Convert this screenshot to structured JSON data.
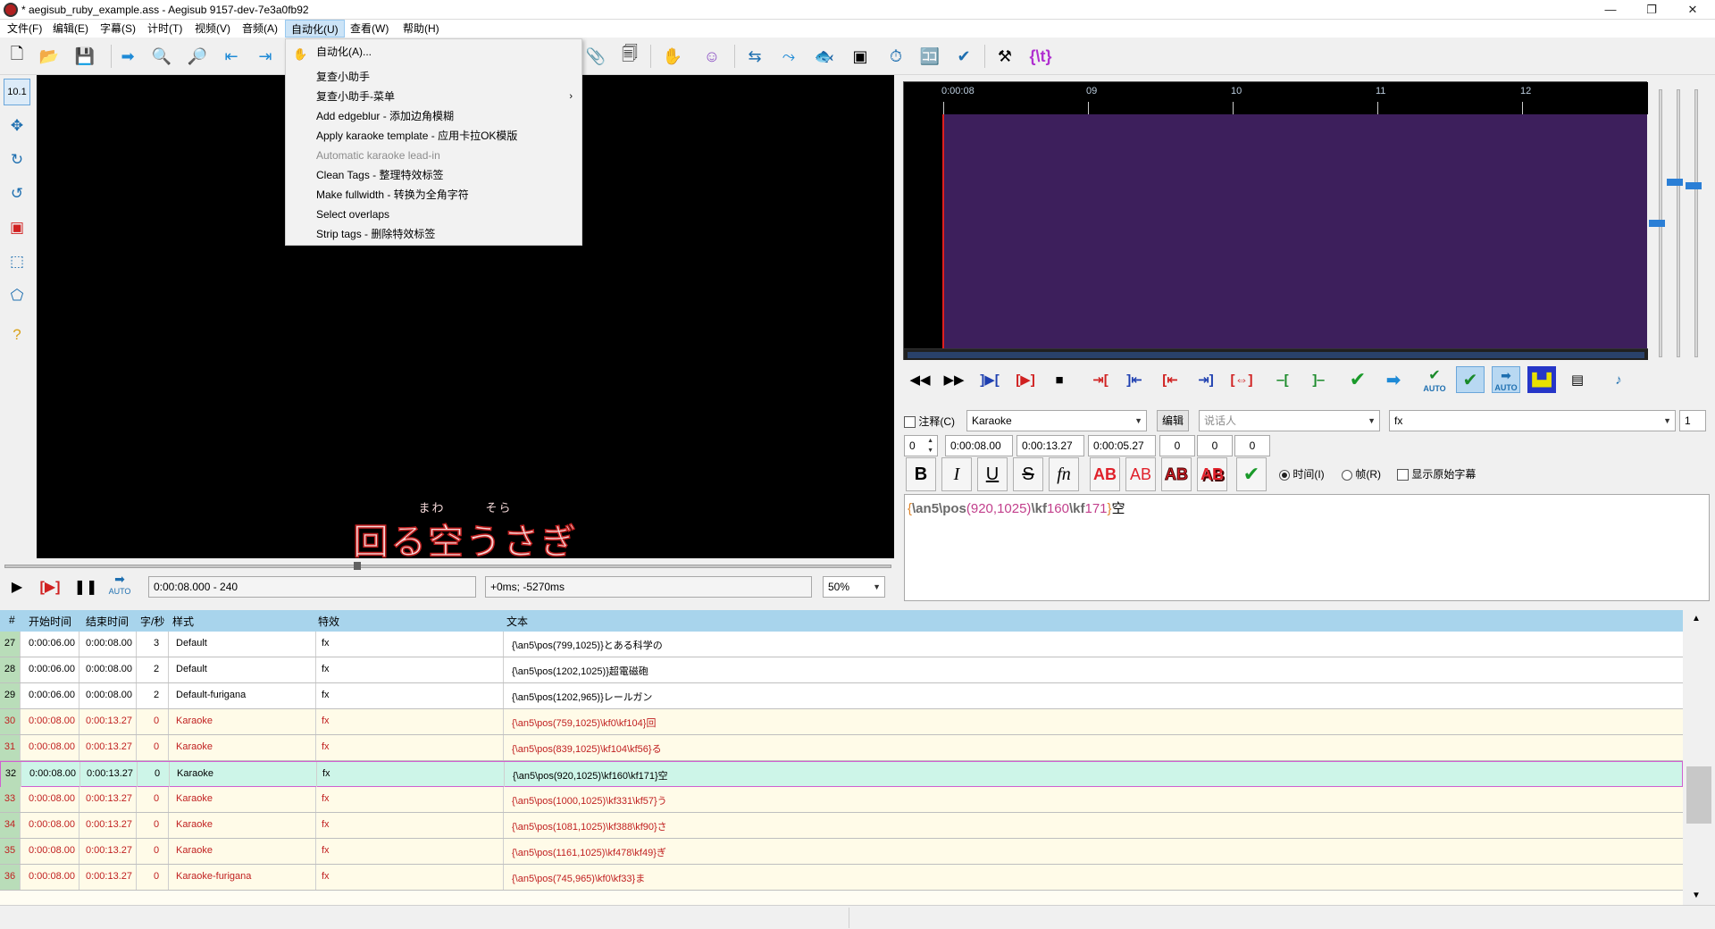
{
  "window": {
    "title": "* aegisub_ruby_example.ass - Aegisub 9157-dev-7e3a0fb92",
    "controls": [
      "—",
      "❐",
      "✕"
    ]
  },
  "menu": [
    "文件(F)",
    "编辑(E)",
    "字幕(S)",
    "计时(T)",
    "视频(V)",
    "音频(A)",
    "自动化(U)",
    "查看(W)",
    "帮助(H)"
  ],
  "automation_menu": {
    "items": [
      {
        "label": "自动化(A)..."
      },
      {
        "label": "复查小助手"
      },
      {
        "label": "复查小助手-菜单",
        "submenu": true
      },
      {
        "label": "Add edgeblur - 添加边角模糊"
      },
      {
        "label": "Apply karaoke template - 应用卡拉OK模版"
      },
      {
        "label": "Automatic karaoke lead-in",
        "disabled": true
      },
      {
        "label": "Clean Tags - 整理特效标签"
      },
      {
        "label": "Make fullwidth - 转换为全角字符"
      },
      {
        "label": "Select overlaps"
      },
      {
        "label": "Strip tags - 删除特效标签"
      }
    ],
    "submenu_arrow": "›"
  },
  "video": {
    "zoom_label": "10.1",
    "ruby_text": "まわ　　　そら",
    "subtitle_text": "回る空うさぎ",
    "time_display": "0:00:08.000 - 240",
    "offset_display": "+0ms; -5270ms",
    "zoom": "50%",
    "auto_label": "AUTO"
  },
  "audio": {
    "ticks": [
      "0:00:08",
      "09",
      "10",
      "11",
      "12"
    ],
    "auto_label": "AUTO"
  },
  "edit": {
    "comment_label": "注释(C)",
    "style": "Karaoke",
    "edit_button": "编辑",
    "actor_placeholder": "说话人",
    "effect": "fx",
    "margin_line": "1",
    "layer": "0",
    "start_time": "0:00:08.00",
    "end_time": "0:00:13.27",
    "duration": "0:00:05.27",
    "margin_l": "0",
    "margin_r": "0",
    "margin_v": "0",
    "bold": "B",
    "italic": "I",
    "underline": "U",
    "strike": "S",
    "font": "fn",
    "color_label": "AB",
    "time_radio": "时间(I)",
    "frame_radio": "帧(R)",
    "show_original": "显示原始字幕",
    "text_tokens": {
      "brace_open": "{",
      "tag1": "\\an5",
      "tag2": "\\pos",
      "pos_args": "(920,1025)",
      "tag3": "\\kf",
      "kf1": "160",
      "tag4": "\\kf",
      "kf2": "171",
      "brace_close": "}",
      "text": "空"
    }
  },
  "colors": {
    "waveform_bg": "#3d1f5c",
    "selected_row": "#cdf5e8",
    "karaoke_text": "#c01f1f",
    "grid_header": "#a8d4ec"
  },
  "grid": {
    "headers": [
      "#",
      "开始时间",
      "结束时间",
      "字/秒",
      "样式",
      "特效",
      "文本"
    ],
    "rows": [
      {
        "n": "27",
        "start": "0:00:06.00",
        "end": "0:00:08.00",
        "cps": "3",
        "style": "Default",
        "effect": "fx",
        "text": "{\\an5\\pos(799,1025)}とある科学の",
        "kind": "white"
      },
      {
        "n": "28",
        "start": "0:00:06.00",
        "end": "0:00:08.00",
        "cps": "2",
        "style": "Default",
        "effect": "fx",
        "text": "{\\an5\\pos(1202,1025)}超電磁砲",
        "kind": "white"
      },
      {
        "n": "29",
        "start": "0:00:06.00",
        "end": "0:00:08.00",
        "cps": "2",
        "style": "Default-furigana",
        "effect": "fx",
        "text": "{\\an5\\pos(1202,965)}レールガン",
        "kind": "white"
      },
      {
        "n": "30",
        "start": "0:00:08.00",
        "end": "0:00:13.27",
        "cps": "0",
        "style": "Karaoke",
        "effect": "fx",
        "text": "{\\an5\\pos(759,1025)\\kf0\\kf104}回",
        "kind": "cream"
      },
      {
        "n": "31",
        "start": "0:00:08.00",
        "end": "0:00:13.27",
        "cps": "0",
        "style": "Karaoke",
        "effect": "fx",
        "text": "{\\an5\\pos(839,1025)\\kf104\\kf56}る",
        "kind": "cream"
      },
      {
        "n": "32",
        "start": "0:00:08.00",
        "end": "0:00:13.27",
        "cps": "0",
        "style": "Karaoke",
        "effect": "fx",
        "text": "{\\an5\\pos(920,1025)\\kf160\\kf171}空",
        "kind": "sel"
      },
      {
        "n": "33",
        "start": "0:00:08.00",
        "end": "0:00:13.27",
        "cps": "0",
        "style": "Karaoke",
        "effect": "fx",
        "text": "{\\an5\\pos(1000,1025)\\kf331\\kf57}う",
        "kind": "cream"
      },
      {
        "n": "34",
        "start": "0:00:08.00",
        "end": "0:00:13.27",
        "cps": "0",
        "style": "Karaoke",
        "effect": "fx",
        "text": "{\\an5\\pos(1081,1025)\\kf388\\kf90}さ",
        "kind": "cream"
      },
      {
        "n": "35",
        "start": "0:00:08.00",
        "end": "0:00:13.27",
        "cps": "0",
        "style": "Karaoke",
        "effect": "fx",
        "text": "{\\an5\\pos(1161,1025)\\kf478\\kf49}ぎ",
        "kind": "cream"
      },
      {
        "n": "36",
        "start": "0:00:08.00",
        "end": "0:00:13.27",
        "cps": "0",
        "style": "Karaoke-furigana",
        "effect": "fx",
        "text": "{\\an5\\pos(745,965)\\kf0\\kf33}ま",
        "kind": "cream"
      }
    ],
    "scroll_up": "▲",
    "scroll_down": "▼"
  }
}
